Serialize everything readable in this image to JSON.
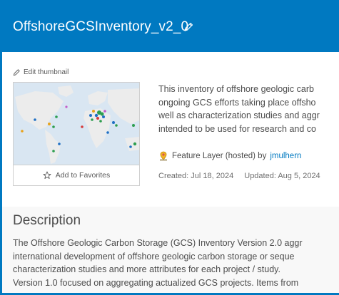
{
  "header": {
    "title": "OffshoreGCSInventory_v2_0"
  },
  "thumbnail": {
    "edit_label": "Edit thumbnail",
    "favorites_label": "Add to Favorites"
  },
  "summary": {
    "lines": [
      "This inventory of offshore geologic carb",
      "ongoing GCS efforts taking place offsho",
      "well as characterization studies and aggr",
      "intended to be used for research and co"
    ]
  },
  "item": {
    "type_label": "Feature Layer (hosted) by",
    "owner": "jmulhern",
    "created": "Created: Jul 18, 2024",
    "updated": "Updated: Aug 5, 2024"
  },
  "description": {
    "title": "Description",
    "lines": [
      "The Offshore Geologic Carbon Storage (GCS) Inventory Version 2.0 aggr",
      "international development of offshore geologic carbon storage or seque",
      "characterization studies and more attributes for each project / study.",
      "Version 1.0 focused on aggregating actualized GCS projects. Items from"
    ]
  },
  "colors": {
    "accent": "#0079c1",
    "link": "#0079c1",
    "text": "#4c4c4c"
  }
}
